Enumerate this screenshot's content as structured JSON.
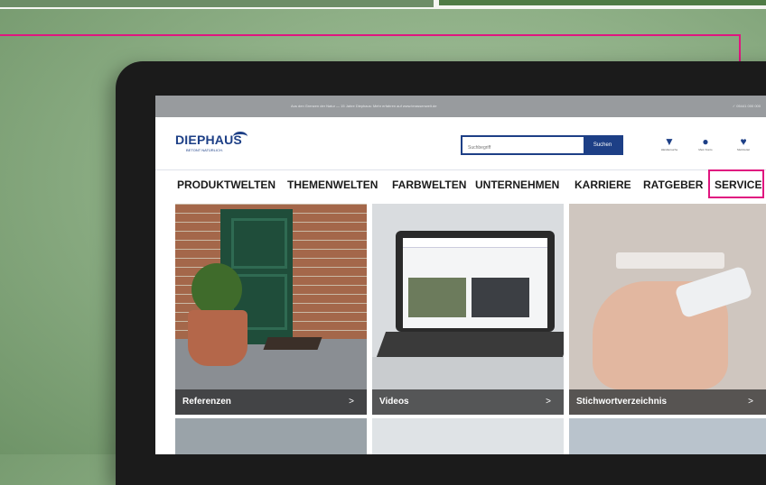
{
  "notice": {
    "message": "Aus den Grenzen der Natur — 15 Jahre Diephaus: Mehr erfahren auf www.terassenwelt.de",
    "right": "✓ 05441 000 000"
  },
  "logo": {
    "name": "DIEPHAUS",
    "tagline": "BETONT NATÜRLICH."
  },
  "search": {
    "placeholder": "Suchbegriff",
    "button": "Suchen"
  },
  "header_icons": [
    {
      "icon": "location-pin-icon",
      "glyph": "⬤",
      "label": "Händlersuche"
    },
    {
      "icon": "user-icon",
      "glyph": "●",
      "label": "Mein Konto"
    },
    {
      "icon": "heart-icon",
      "glyph": "♥",
      "label": "Merkzettel"
    }
  ],
  "nav": [
    "PRODUKTWELTEN",
    "THEMENWELTEN",
    "FARBWELTEN",
    "UNTERNEHMEN",
    "KARRIERE",
    "RATGEBER",
    "SERVICE"
  ],
  "tiles": [
    {
      "label": "Referenzen",
      "arrow": ">"
    },
    {
      "label": "Videos",
      "arrow": ">"
    },
    {
      "label": "Stichwortverzeichnis",
      "arrow": ">"
    }
  ],
  "colors": {
    "brand": "#1d3f86",
    "highlight": "#e0167f"
  }
}
